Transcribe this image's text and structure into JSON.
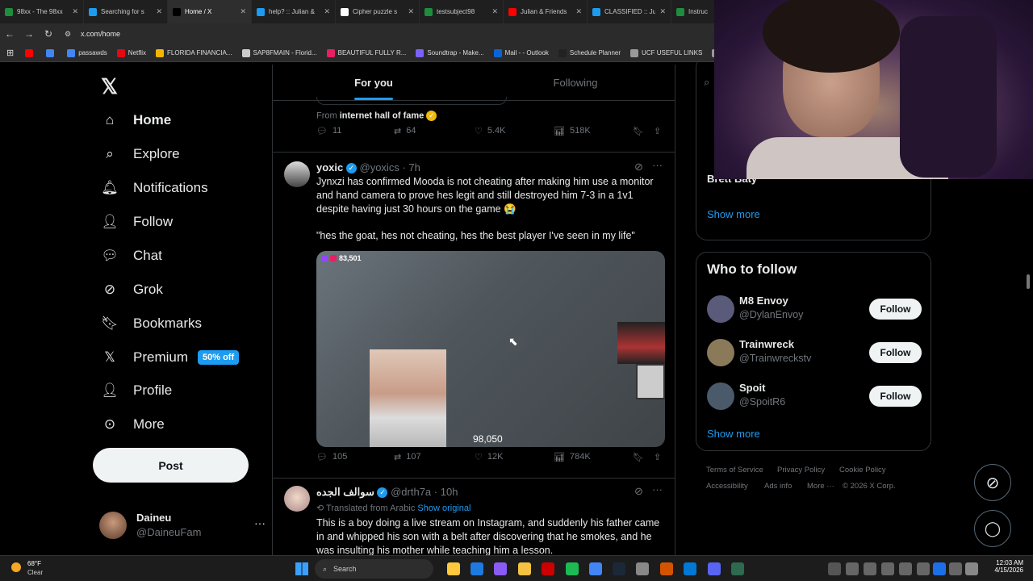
{
  "browser": {
    "tabs": [
      {
        "label": "98xx - The 98xx",
        "color": "#1e8e3e"
      },
      {
        "label": "Searching for s",
        "color": "#1d9bf0"
      },
      {
        "label": "Home / X",
        "color": "#000000"
      },
      {
        "label": "help? :: Julian &",
        "color": "#1d9bf0"
      },
      {
        "label": "Cipher puzzle s",
        "color": "#ffffff"
      },
      {
        "label": "testsubject98",
        "color": "#1e8e3e"
      },
      {
        "label": "Julian & Friends",
        "color": "#ff0000"
      },
      {
        "label": "CLASSIFIED :: Ju",
        "color": "#1d9bf0"
      },
      {
        "label": "Instruc",
        "color": "#1e8e3e"
      }
    ],
    "url": "x.com/home",
    "bookmarks": [
      {
        "label": "",
        "color": "#ff0000"
      },
      {
        "label": "",
        "color": "#4285f4"
      },
      {
        "label": "passawds",
        "color": "#4285f4"
      },
      {
        "label": "Netflix",
        "color": "#e50914"
      },
      {
        "label": "FLORIDA FINANCIA...",
        "color": "#f5b400"
      },
      {
        "label": "SAP8FMAIN - Florid...",
        "color": "#cccccc"
      },
      {
        "label": "BEAUTIFUL FULLY R...",
        "color": "#e91e63"
      },
      {
        "label": "Soundtrap - Make...",
        "color": "#7b61ff"
      },
      {
        "label": "Mail - - Outlook",
        "color": "#0a64d6"
      },
      {
        "label": "Schedule Planner",
        "color": "#222222"
      },
      {
        "label": "UCF USEFUL LINKS",
        "color": "#999999"
      },
      {
        "label": "U",
        "color": "#999999"
      }
    ]
  },
  "sidebar": {
    "items": [
      {
        "label": "Home",
        "icon": "home-icon"
      },
      {
        "label": "Explore",
        "icon": "search-icon"
      },
      {
        "label": "Notifications",
        "icon": "bell-icon"
      },
      {
        "label": "Follow",
        "icon": "add-person-icon"
      },
      {
        "label": "Chat",
        "icon": "chat-icon"
      },
      {
        "label": "Grok",
        "icon": "grok-icon"
      },
      {
        "label": "Bookmarks",
        "icon": "bookmark-icon"
      },
      {
        "label": "Premium",
        "icon": "x-logo-icon",
        "badge": "50% off"
      },
      {
        "label": "Profile",
        "icon": "person-icon"
      },
      {
        "label": "More",
        "icon": "more-circle-icon"
      }
    ],
    "post_label": "Post",
    "account": {
      "name": "Daineu",
      "handle": "@DaineuFam"
    }
  },
  "feed": {
    "tabs": [
      "For you",
      "Following"
    ],
    "prev_post": {
      "from_prefix": "From",
      "from_name": "internet hall of fame",
      "replies": "11",
      "reposts": "64",
      "likes": "5.4K",
      "views": "518K"
    },
    "post1": {
      "name": "yoxic",
      "handle": "@yoxics",
      "time": "· 7h",
      "text1": "Jynxzi has confirmed Mooda is not cheating after making him use a monitor and hand camera to prove hes legit and still destroyed him 7-3 in a 1v1 despite having just 30 hours on the game 😭",
      "text2": "\"hes the goat, hes not cheating, hes the best player I've seen in my life\"",
      "viewers": "83,501",
      "overlay_count": "98,050",
      "replies": "105",
      "reposts": "107",
      "likes": "12K",
      "views": "784K"
    },
    "post2": {
      "name": "سوالف الجده",
      "handle": "@drth7a",
      "time": "· 10h",
      "translated": "Translated from Arabic",
      "show_original": "Show original",
      "text": "This is a boy doing a live stream on Instagram, and suddenly his father came in and whipped his son with a belt after discovering that he smokes, and he was insulting his mother while teaching him a lesson."
    }
  },
  "right": {
    "trend_top_name": "Brett Baty",
    "trend_show_more": "Show more",
    "wtf_title": "Who to follow",
    "wtf": [
      {
        "name": "M8 Envoy",
        "handle": "@DylanEnvoy",
        "follow": "Follow"
      },
      {
        "name": "Trainwreck",
        "handle": "@Trainwreckstv",
        "follow": "Follow"
      },
      {
        "name": "Spoit",
        "handle": "@SpoitR6",
        "follow": "Follow"
      }
    ],
    "wtf_show_more": "Show more",
    "footer": [
      "Terms of Service",
      "Privacy Policy",
      "Cookie Policy",
      "Accessibility",
      "Ads info",
      "More ···",
      "© 2026 X Corp."
    ]
  },
  "taskbar": {
    "weather_temp": "68°F",
    "weather_desc": "Clear",
    "search_placeholder": "Search",
    "time": "12:03 AM",
    "date": "4/15/2026"
  }
}
